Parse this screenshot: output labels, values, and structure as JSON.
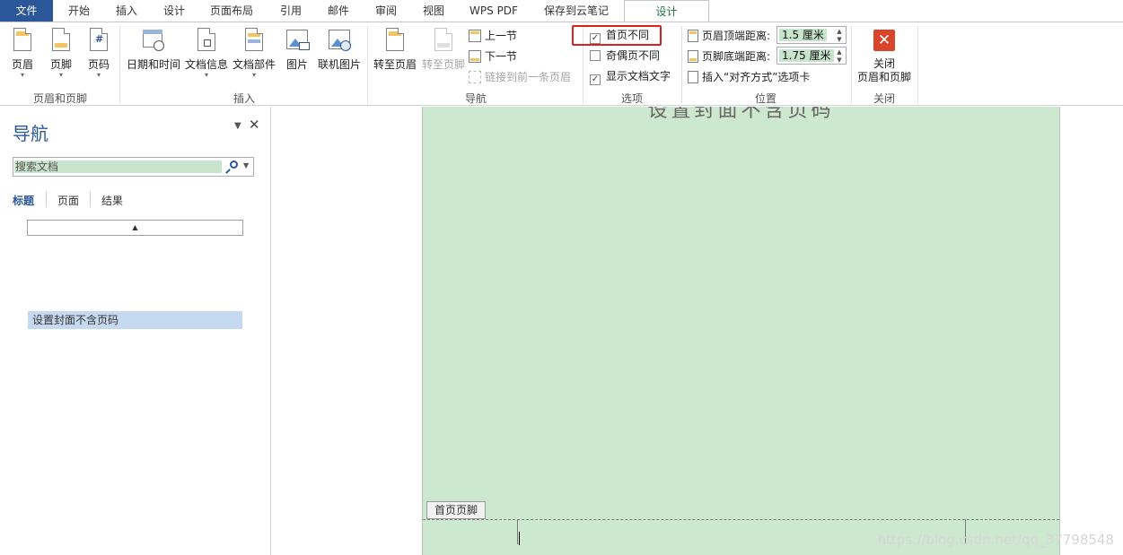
{
  "tabs": [
    {
      "label": "文件"
    },
    {
      "label": "开始"
    },
    {
      "label": "插入"
    },
    {
      "label": "设计"
    },
    {
      "label": "页面布局"
    },
    {
      "label": "引用"
    },
    {
      "label": "邮件"
    },
    {
      "label": "审阅"
    },
    {
      "label": "视图"
    },
    {
      "label": "WPS PDF"
    },
    {
      "label": "保存到云笔记"
    },
    {
      "label": "设计"
    }
  ],
  "ribbon": {
    "header_footer": {
      "group_label": "页眉和页脚",
      "header": "页眉",
      "footer": "页脚",
      "page_number": "页码",
      "page_number_icon": "#"
    },
    "insert": {
      "group_label": "插入",
      "date_time": "日期和时间",
      "doc_info": "文档信息",
      "doc_parts": "文档部件",
      "picture": "图片",
      "online_picture": "联机图片"
    },
    "navigation": {
      "group_label": "导航",
      "goto_header": "转至页眉",
      "goto_footer": "转至页脚",
      "prev_section": "上一节",
      "next_section": "下一节",
      "link_previous": "链接到前一条页眉"
    },
    "options": {
      "group_label": "选项",
      "different_first_page": "首页不同",
      "different_first_page_checked": true,
      "different_odd_even": "奇偶页不同",
      "different_odd_even_checked": false,
      "show_doc_text": "显示文档文字",
      "show_doc_text_checked": true
    },
    "position": {
      "group_label": "位置",
      "header_top_label": "页眉顶端距离:",
      "header_top_value": "1.5 厘米",
      "footer_bottom_label": "页脚底端距离:",
      "footer_bottom_value": "1.75 厘米",
      "insert_align_tab": "插入“对齐方式”选项卡"
    },
    "close": {
      "group_label": "关闭",
      "close_line1": "关闭",
      "close_line2": "页眉和页脚"
    }
  },
  "nav": {
    "title": "导航",
    "search_placeholder": "搜索文档",
    "tabs": [
      "标题",
      "页面",
      "结果"
    ],
    "headings": [
      "设置封面不含页码"
    ]
  },
  "document": {
    "title_text": "设置封面不含页码",
    "footer_tag": "首页页脚",
    "watermark": "https://blog.csdn.net/qq_37798548"
  },
  "colors": {
    "file_tab": "#2b579a",
    "active_tab_text": "#217346",
    "page_bg": "#cce8cf",
    "highlight_box": "#e02020",
    "nav_selected": "#c5d9f1"
  }
}
